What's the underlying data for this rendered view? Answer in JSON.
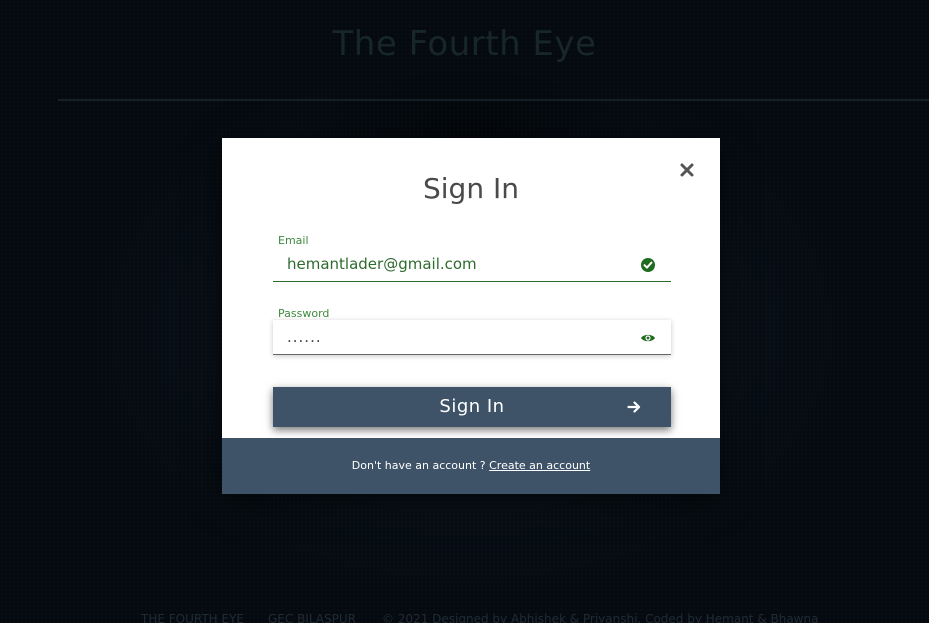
{
  "site": {
    "title": "The Fourth Eye"
  },
  "modal": {
    "title": "Sign In",
    "close_icon": "close-icon",
    "email": {
      "label": "Email",
      "value": "hemantlader@gmail.com",
      "status_icon": "check-circle-icon"
    },
    "password": {
      "label": "Password",
      "value": "......",
      "toggle_icon": "eye-icon"
    },
    "submit": {
      "label": "Sign In",
      "icon": "arrow-right-icon"
    },
    "footer": {
      "prompt": "Don't have an account ?",
      "link": "Create an account"
    }
  },
  "page_footer": {
    "items": [
      "THE FOURTH EYE",
      "GEC BILASPUR",
      "© 2021   Designed by Abhishek & Priyanshi, Coded by Hemant & Bhawna"
    ]
  },
  "colors": {
    "accent": "#3e5268",
    "valid_green": "#1f6b1f",
    "label_green": "#3e8a3e"
  }
}
